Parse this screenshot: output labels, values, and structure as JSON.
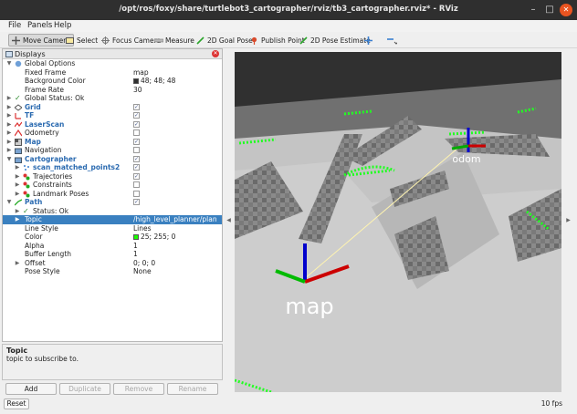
{
  "window": {
    "title": "/opt/ros/foxy/share/turtlebot3_cartographer/rviz/tb3_cartographer.rviz* - RViz"
  },
  "menu": {
    "file": "File",
    "panels": "Panels",
    "help": "Help"
  },
  "toolbar": {
    "move_camera": "Move Camera",
    "select": "Select",
    "focus_camera": "Focus Camera",
    "measure": "Measure",
    "goal_pose": "2D Goal Pose",
    "publish_point": "Publish Point",
    "pose_estimate": "2D Pose Estimate"
  },
  "displays": {
    "title": "Displays",
    "rows": [
      {
        "label": "Global Options",
        "value": ""
      },
      {
        "label": "Fixed Frame",
        "value": "map"
      },
      {
        "label": "Background Color",
        "value": "48; 48; 48"
      },
      {
        "label": "Frame Rate",
        "value": "30"
      },
      {
        "label": "Global Status: Ok",
        "value": ""
      },
      {
        "label": "Grid",
        "value": ""
      },
      {
        "label": "TF",
        "value": ""
      },
      {
        "label": "LaserScan",
        "value": ""
      },
      {
        "label": "Odometry",
        "value": ""
      },
      {
        "label": "Map",
        "value": ""
      },
      {
        "label": "Navigation",
        "value": ""
      },
      {
        "label": "Cartographer",
        "value": ""
      },
      {
        "label": "scan_matched_points2",
        "value": ""
      },
      {
        "label": "Trajectories",
        "value": ""
      },
      {
        "label": "Constraints",
        "value": ""
      },
      {
        "label": "Landmark Poses",
        "value": ""
      },
      {
        "label": "Path",
        "value": ""
      },
      {
        "label": "Status: Ok",
        "value": ""
      },
      {
        "label": "Topic",
        "value": "/high_level_planner/plan"
      },
      {
        "label": "Line Style",
        "value": "Lines"
      },
      {
        "label": "Color",
        "value": "25; 255; 0"
      },
      {
        "label": "Alpha",
        "value": "1"
      },
      {
        "label": "Buffer Length",
        "value": "1"
      },
      {
        "label": "Offset",
        "value": "0; 0; 0"
      },
      {
        "label": "Pose Style",
        "value": "None"
      }
    ]
  },
  "description": {
    "title": "Topic",
    "text": "topic to subscribe to."
  },
  "panel_buttons": {
    "add": "Add",
    "duplicate": "Duplicate",
    "remove": "Remove",
    "rename": "Rename"
  },
  "status": {
    "reset": "Reset",
    "fps": "10 fps"
  },
  "viewport": {
    "map_label": "map",
    "odom_label": "odom",
    "background_color": "#303030",
    "path_color": "#19ff00"
  }
}
